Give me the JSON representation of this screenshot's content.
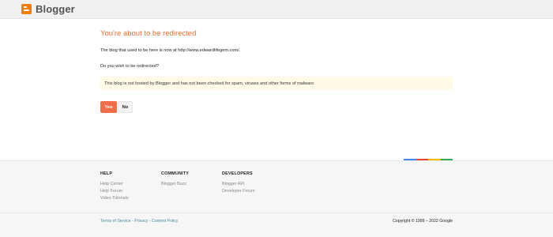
{
  "header": {
    "logo_text": "Blogger"
  },
  "main": {
    "title": "You're about to be redirected",
    "moved_text": "The blog that used to be here is now at http://www.edwardlifegem.com/.",
    "question": "Do you wish to be redirected?",
    "notice": "This blog is not hosted by Blogger and has not been checked for spam, viruses and other forms of malware.",
    "yes_label": "Yes",
    "no_label": "No"
  },
  "colors": {
    "accent": "#f26d2e",
    "yes_button": "#f26d4a",
    "notice_bg": "#fffbe7",
    "stripe": [
      "#4285f4",
      "#ea4335",
      "#fbbc05",
      "#34a853"
    ]
  },
  "footer": {
    "help": {
      "title": "HELP",
      "links": [
        "Help Center",
        "Help Forum",
        "Video Tutorials"
      ]
    },
    "community": {
      "title": "COMMUNITY",
      "links": [
        "Blogger Buzz"
      ]
    },
    "developers": {
      "title": "DEVELOPERS",
      "links": [
        "Blogger API",
        "Developer Forum"
      ]
    },
    "legal": {
      "terms": "Terms of Service",
      "sep1": " - ",
      "privacy": "Privacy",
      "sep2": " - ",
      "content_policy": "Content Policy"
    },
    "copyright": "Copyright © 1999 – 2022 Google"
  }
}
